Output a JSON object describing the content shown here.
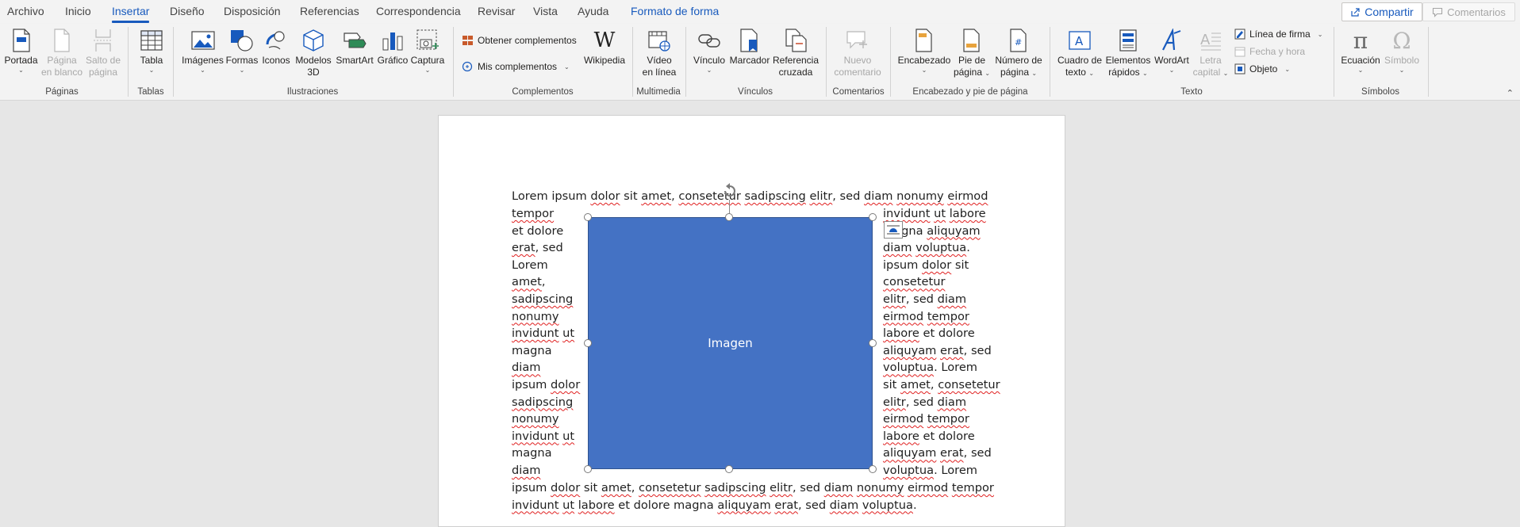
{
  "tabs": [
    "Archivo",
    "Inicio",
    "Insertar",
    "Diseño",
    "Disposición",
    "Referencias",
    "Correspondencia",
    "Revisar",
    "Vista",
    "Ayuda",
    "Formato de forma"
  ],
  "active_tab": "Insertar",
  "share_label": "Compartir",
  "comments_label": "Comentarios",
  "groups": {
    "paginas": {
      "label": "Páginas",
      "portada": "Portada",
      "pagina_blanco_1": "Página",
      "pagina_blanco_2": "en blanco",
      "salto_1": "Salto de",
      "salto_2": "página"
    },
    "tablas": {
      "label": "Tablas",
      "tabla": "Tabla"
    },
    "ilustraciones": {
      "label": "Ilustraciones",
      "imagenes": "Imágenes",
      "formas": "Formas",
      "iconos": "Iconos",
      "modelos_1": "Modelos",
      "modelos_2": "3D",
      "smartart": "SmartArt",
      "grafico": "Gráfico",
      "captura": "Captura"
    },
    "complementos": {
      "label": "Complementos",
      "obtener": "Obtener complementos",
      "mis": "Mis complementos",
      "wikipedia": "Wikipedia"
    },
    "multimedia": {
      "label": "Multimedia",
      "video_1": "Vídeo",
      "video_2": "en línea"
    },
    "vinculos": {
      "label": "Vínculos",
      "vinculo": "Vínculo",
      "marcador": "Marcador",
      "referencia_1": "Referencia",
      "referencia_2": "cruzada"
    },
    "comentarios": {
      "label": "Comentarios",
      "nuevo_1": "Nuevo",
      "nuevo_2": "comentario"
    },
    "encabezado": {
      "label": "Encabezado y pie de página",
      "encabezado": "Encabezado",
      "pie_1": "Pie de",
      "pie_2": "página",
      "numero_1": "Número de",
      "numero_2": "página"
    },
    "texto": {
      "label": "Texto",
      "cuadro_1": "Cuadro de",
      "cuadro_2": "texto",
      "elementos_1": "Elementos",
      "elementos_2": "rápidos",
      "wordart": "WordArt",
      "letra_1": "Letra",
      "letra_2": "capital",
      "linea_firma": "Línea de firma",
      "fecha_hora": "Fecha y hora",
      "objeto": "Objeto"
    },
    "simbolos": {
      "label": "Símbolos",
      "ecuacion": "Ecuación",
      "simbolo": "Símbolo"
    }
  },
  "colors": {
    "accent": "#185abd",
    "shape_fill": "#4472c4",
    "spell_underline": "#e02020"
  },
  "shape_label": "Imagen",
  "doc": {
    "top_line": [
      "Lorem ipsum ",
      "dolor",
      " sit ",
      "amet",
      ", ",
      "consetetur",
      " ",
      "sadipscing",
      " ",
      "elitr",
      ", sed ",
      "diam",
      " ",
      "nonumy",
      " ",
      "eirmod"
    ],
    "left": [
      [
        "tempor"
      ],
      [
        "et dolore"
      ],
      [
        "erat",
        ", sed"
      ],
      [
        "Lorem"
      ],
      [
        "amet",
        ","
      ],
      [
        "sadipscing"
      ],
      [
        "nonumy"
      ],
      [
        "invidunt",
        " ",
        "ut"
      ],
      [
        "magna"
      ],
      [
        "diam"
      ],
      [
        "ipsum ",
        "dolor"
      ],
      [
        "sadipscing"
      ],
      [
        "nonumy"
      ],
      [
        "invidunt",
        " ",
        "ut"
      ],
      [
        "magna"
      ],
      [
        "diam"
      ]
    ],
    "right": [
      [
        "invidunt",
        " ",
        "ut",
        " ",
        "labore"
      ],
      [
        "magna ",
        "aliquyam"
      ],
      [
        "diam",
        " ",
        "voluptua",
        "."
      ],
      [
        "ipsum ",
        "dolor",
        " sit"
      ],
      [
        "consetetur"
      ],
      [
        "elitr",
        ", sed ",
        "diam"
      ],
      [
        "eirmod",
        " ",
        "tempor"
      ],
      [
        "labore",
        " et dolore"
      ],
      [
        "aliquyam",
        " ",
        "erat",
        ", sed"
      ],
      [
        "voluptua",
        ". Lorem"
      ],
      [
        "sit ",
        "amet",
        ", ",
        "consetetur"
      ],
      [
        "elitr",
        ", sed ",
        "diam"
      ],
      [
        "eirmod",
        " ",
        "tempor"
      ],
      [
        "labore",
        " et dolore"
      ],
      [
        "aliquyam",
        " ",
        "erat",
        ", sed"
      ],
      [
        "voluptua",
        ". Lorem"
      ]
    ],
    "bottom": [
      [
        "ipsum ",
        "dolor",
        " sit ",
        "amet",
        ", ",
        "consetetur",
        " ",
        "sadipscing",
        " ",
        "elitr",
        ", sed ",
        "diam",
        " ",
        "nonumy",
        " ",
        "eirmod",
        " ",
        "tempor"
      ],
      [
        "invidunt",
        " ",
        "ut",
        " ",
        "labore",
        " et dolore magna ",
        "aliquyam",
        " ",
        "erat",
        ", sed ",
        "diam",
        " ",
        "voluptua",
        "."
      ]
    ],
    "misspelled": [
      "dolor",
      "amet",
      "consetetur",
      "sadipscing",
      "elitr",
      "diam",
      "nonumy",
      "eirmod",
      "tempor",
      "invidunt",
      "ut",
      "labore",
      "aliquyam",
      "voluptua",
      "erat"
    ]
  }
}
